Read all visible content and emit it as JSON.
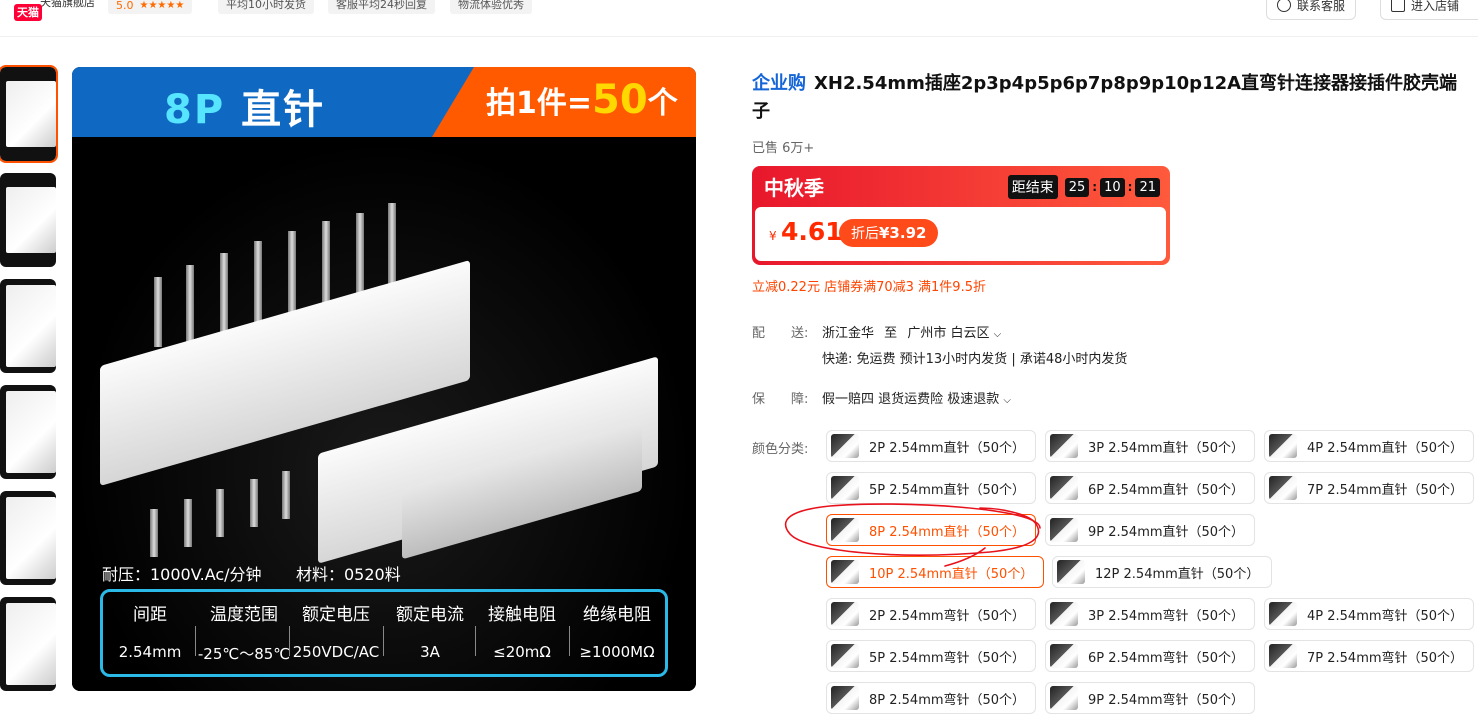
{
  "header": {
    "shop_name": "天猫旗舰店",
    "tmall_badge": "天猫",
    "rating": "5.0",
    "stars": "★★★★★",
    "tags": [
      "平均10小时发货",
      "客服平均24秒回复",
      "物流体验优秀"
    ],
    "contact_btn": "联系客服",
    "enter_shop_btn": "进入店铺"
  },
  "gallery": {
    "headline_count": "8P",
    "headline_text": "直针",
    "promo_prefix": "拍1件=",
    "promo_num": "50",
    "promo_suffix": "个",
    "voltage_note": "耐压：1000V.Ac/分钟",
    "material_note": "材料：0520料",
    "specs": [
      {
        "h": "间距",
        "v": "2.54mm"
      },
      {
        "h": "温度范围",
        "v": "-25℃～85℃"
      },
      {
        "h": "额定电压",
        "v": "250VDC/AC"
      },
      {
        "h": "额定电流",
        "v": "3A"
      },
      {
        "h": "接触电阻",
        "v": "≤20mΩ"
      },
      {
        "h": "绝缘电阻",
        "v": "≥1000MΩ"
      }
    ]
  },
  "product": {
    "badge": "企业购",
    "title": "XH2.54mm插座2p3p4p5p6p7p8p9p10p12A直弯针连接器接插件胶壳端子",
    "sold": "已售 6万+",
    "festival": "中秋季",
    "countdown_label": "距结束",
    "countdown": [
      "25",
      "10",
      "21"
    ],
    "currency": "¥",
    "price": "4.61",
    "after_label": "折后",
    "after_price": "¥3.92",
    "coupon_line": "立减0.22元 店铺券满70减3 满1件9.5折"
  },
  "delivery": {
    "label": "配　　送:",
    "from": "浙江金华",
    "to_word": "至",
    "dest": "广州市 白云区",
    "line2": "快递: 免运费  预计13小时内发货 | 承诺48小时内发货"
  },
  "guarantee": {
    "label": "保　　障:",
    "text": "假一赔四 退货运费险 极速退款"
  },
  "sku": {
    "label": "颜色分类:",
    "options": [
      "2P 2.54mm直针（50个）",
      "3P 2.54mm直针（50个）",
      "4P 2.54mm直针（50个）",
      "5P 2.54mm直针（50个）",
      "6P 2.54mm直针（50个）",
      "7P 2.54mm直针（50个）",
      "8P 2.54mm直针（50个）",
      "9P 2.54mm直针（50个）",
      "10P 2.54mm直针（50个）",
      "12P 2.54mm直针（50个）",
      "2P 2.54mm弯针（50个）",
      "3P 2.54mm弯针（50个）",
      "4P 2.54mm弯针（50个）",
      "5P 2.54mm弯针（50个）",
      "6P 2.54mm弯针（50个）",
      "7P 2.54mm弯针（50个）",
      "8P 2.54mm弯针（50个）",
      "9P 2.54mm弯针（50个）"
    ]
  },
  "colors": {
    "accent": "#ff5000",
    "price": "#ff2a00",
    "link_blue": "#1565d8",
    "annotation": "#e8121c"
  }
}
